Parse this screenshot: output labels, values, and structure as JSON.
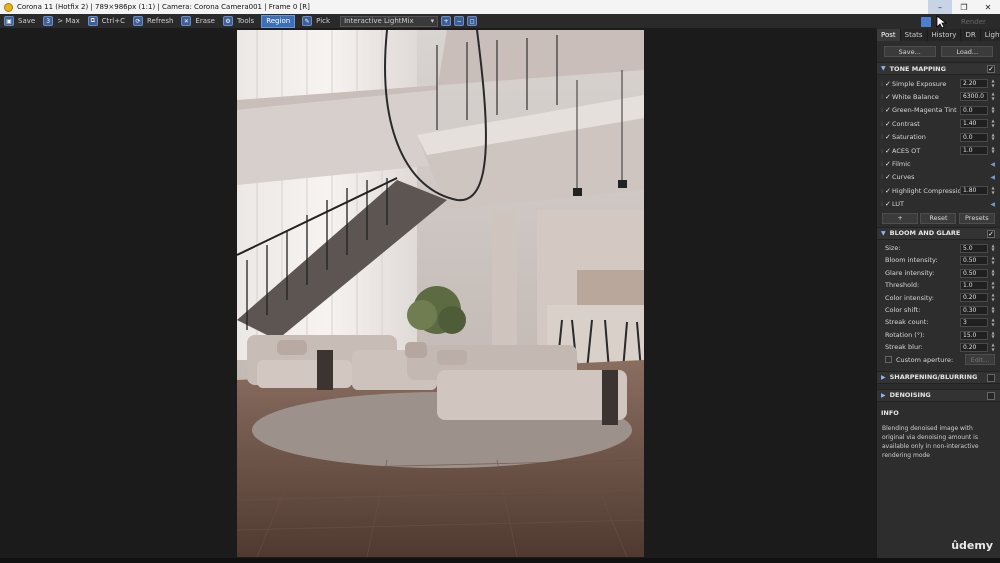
{
  "window": {
    "title": "Corona 11 (Hotfix 2) | 789×986px (1:1) | Camera: Corona Camera001 | Frame 0 [R]"
  },
  "toolbar": {
    "save": "Save",
    "max": "> Max",
    "copy": "Ctrl+C",
    "refresh": "Refresh",
    "erase": "Erase",
    "tools": "Tools",
    "region": "Region",
    "pick": "Pick",
    "mode_select": "Interactive LightMix",
    "render": "Render"
  },
  "panel": {
    "tabs": [
      "Post",
      "Stats",
      "History",
      "DR",
      "LightMix"
    ],
    "save_label": "Save...",
    "load_label": "Load...",
    "tone_mapping": {
      "title": "TONE MAPPING",
      "rows": [
        {
          "label": "Simple Exposure",
          "value": "2.20"
        },
        {
          "label": "White Balance",
          "value": "6300.0"
        },
        {
          "label": "Green-Magenta Tint",
          "value": "0.0"
        },
        {
          "label": "Contrast",
          "value": "1.40"
        },
        {
          "label": "Saturation",
          "value": "0.0"
        },
        {
          "label": "ACES OT",
          "value": "1.0"
        },
        {
          "label": "Filmic",
          "value": ""
        },
        {
          "label": "Curves",
          "value": ""
        },
        {
          "label": "Highlight Compression",
          "value": "1.80"
        },
        {
          "label": "LUT",
          "value": ""
        }
      ],
      "plus": "+",
      "reset": "Reset",
      "presets": "Presets"
    },
    "bloom": {
      "title": "BLOOM AND GLARE",
      "rows": [
        {
          "label": "Size:",
          "value": "5.0"
        },
        {
          "label": "Bloom intensity:",
          "value": "0.50"
        },
        {
          "label": "Glare intensity:",
          "value": "0.50"
        },
        {
          "label": "Threshold:",
          "value": "1.0"
        },
        {
          "label": "Color intensity:",
          "value": "0.20"
        },
        {
          "label": "Color shift:",
          "value": "0.30"
        },
        {
          "label": "Streak count:",
          "value": "3"
        },
        {
          "label": "Rotation (°):",
          "value": "15.0"
        },
        {
          "label": "Streak blur:",
          "value": "0.20"
        }
      ],
      "custom_aperture": "Custom aperture:",
      "edit": "Edit..."
    },
    "sharpening": "SHARPENING/BLURRING",
    "denoising": "DENOISING",
    "info_title": "INFO",
    "info_text": "Blending denoised image with original via denoising amount is available only in non-interactive rendering mode"
  },
  "watermark": "ûdemy",
  "colors": {
    "accent": "#3d6fb7"
  }
}
